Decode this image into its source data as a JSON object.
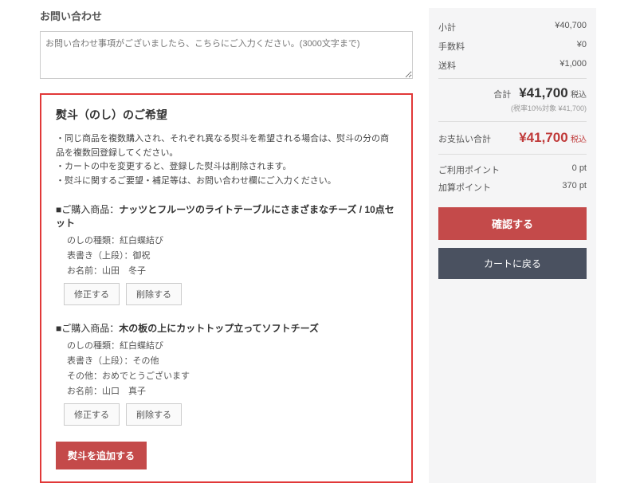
{
  "inquiry": {
    "title": "お問い合わせ",
    "placeholder": "お問い合わせ事項がございましたら、こちらにご入力ください。(3000文字まで)"
  },
  "noshi": {
    "title": "熨斗（のし）のご希望",
    "notes": [
      "・同じ商品を複数購入され、それぞれ異なる熨斗を希望される場合は、熨斗の分の商品を複数回登録してください。",
      "・カートの中を変更すると、登録した熨斗は削除されます。",
      "・熨斗に関するご要望・補足等は、お問い合わせ欄にご入力ください。"
    ],
    "items": [
      {
        "product_label": "■ご購入商品：",
        "product_name": "ナッツとフルーツのライトテーブルにさまざまなチーズ / 10点セット",
        "details": [
          "のしの種類：紅白蝶結び",
          "表書き（上段）：御祝",
          "お名前：山田　冬子"
        ],
        "edit_label": "修正する",
        "delete_label": "削除する"
      },
      {
        "product_label": "■ご購入商品：",
        "product_name": "木の板の上にカットトップ立ってソフトチーズ",
        "details": [
          "のしの種類：紅白蝶結び",
          "表書き（上段）：その他",
          "その他：おめでとうございます",
          "お名前：山口　真子"
        ],
        "edit_label": "修正する",
        "delete_label": "削除する"
      }
    ],
    "add_button": "熨斗を追加する"
  },
  "summary": {
    "subtotal_label": "小計",
    "subtotal_value": "¥40,700",
    "fee_label": "手数料",
    "fee_value": "¥0",
    "shipping_label": "送料",
    "shipping_value": "¥1,000",
    "total_label": "合計",
    "total_value": "¥41,700",
    "total_tax": "税込",
    "tax_note": "(税率10%対象 ¥41,700)",
    "pay_label": "お支払い合計",
    "pay_value": "¥41,700",
    "pay_tax": "税込",
    "use_points_label": "ご利用ポイント",
    "use_points_value": "0 pt",
    "earn_points_label": "加算ポイント",
    "earn_points_value": "370 pt",
    "confirm_button": "確認する",
    "back_button": "カートに戻る"
  }
}
